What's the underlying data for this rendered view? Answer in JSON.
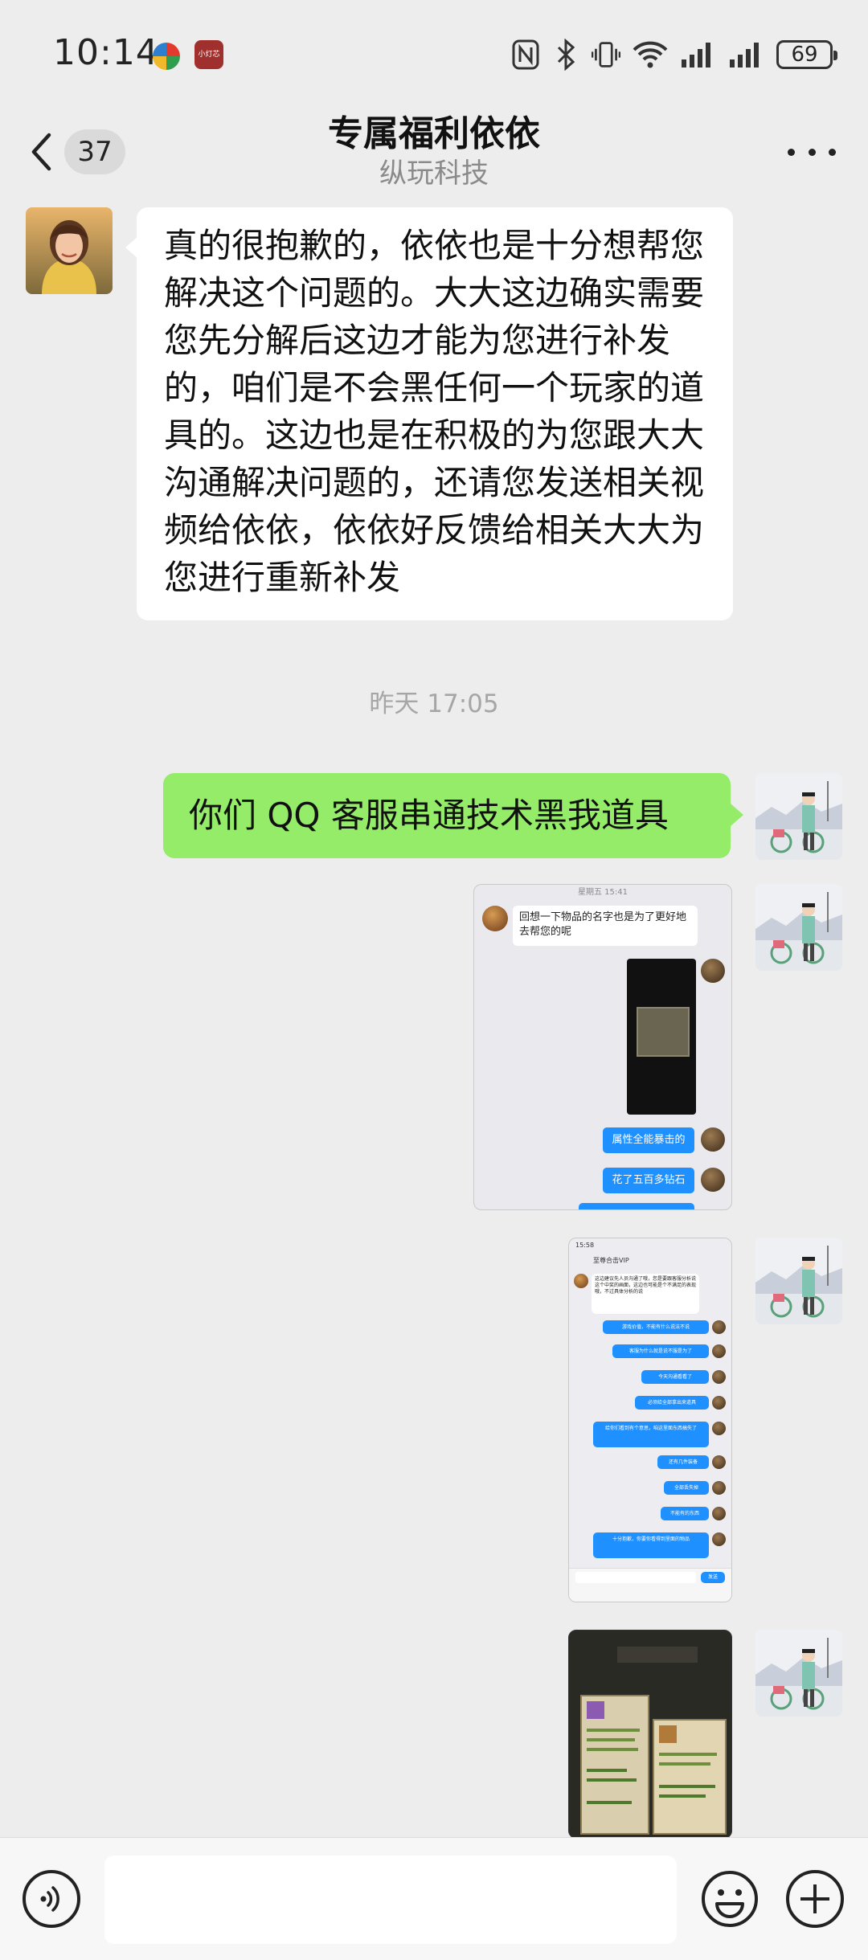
{
  "status_bar": {
    "time": "10:14",
    "app2_text": "小灯芯",
    "battery": "69"
  },
  "header": {
    "back_count": "37",
    "title": "专属福利依依",
    "subtitle": "纵玩科技"
  },
  "messages": {
    "incoming_text": "真的很抱歉的，依依也是十分想帮您解决这个问题的。大大这边确实需要您先分解后这边才能为您进行补发的，咱们是不会黑任何一个玩家的道具的。这边也是在积极的为您跟大大沟通解决问题的，还请您发送相关视频给依依，依依好反馈给相关大大为您进行重新补发",
    "timestamp": "昨天 17:05",
    "outgoing_text": "你们 QQ 客服串通技术黑我道具"
  },
  "screenshot1": {
    "header": "星期五 15:41",
    "bubble_left": "回想一下物品的名字也是为了更好地去帮您的呢",
    "bubble_blue_1": "属性全能暴击的",
    "bubble_blue_2": "花了五百多钻石"
  },
  "screenshot2": {
    "status": "15:58",
    "chat_title": "至尊合击VIP",
    "left_bubble": "这边建议先人员沟通了哦，您是要跟客服分析说这个中奖的画面，这边也可能是个不满足的表现哦，不过具体分析的说",
    "blue_bubbles": [
      "游戏价值，不能有什么说法不说",
      "客服为什么就是说不服是为了",
      "今天沟通看看了",
      "必须给全部拿出来道具",
      "给你们看到有个意思，咱这里面东西搞失了",
      "还有几件装备",
      "全部丢失掉",
      "不能有的东西",
      "十分抱歉，你要你看得到里面的物品"
    ],
    "send": "发送"
  },
  "input": {
    "placeholder": ""
  }
}
